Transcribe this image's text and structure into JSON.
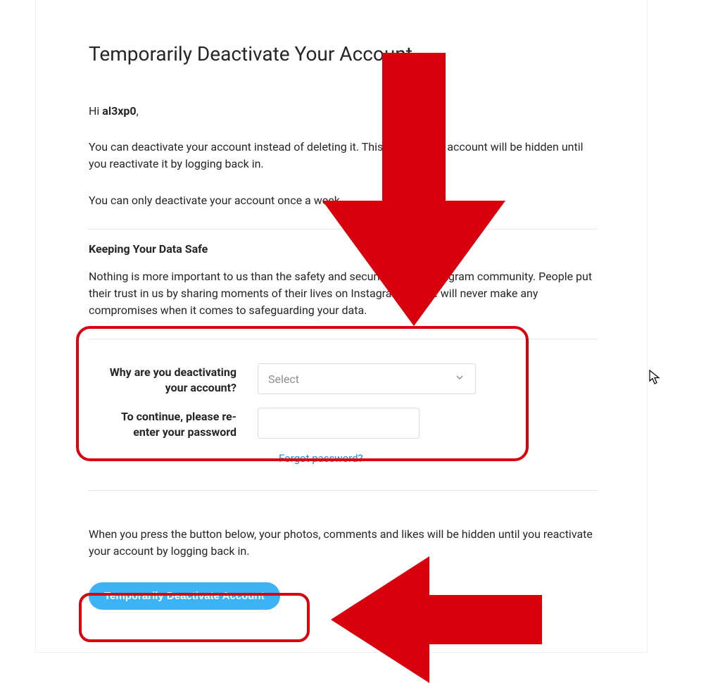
{
  "title": "Temporarily Deactivate Your Account",
  "greeting_prefix": "Hi ",
  "username": "al3xp0",
  "greeting_suffix": ",",
  "intro_para": "You can deactivate your account instead of deleting it. This means your account will be hidden until you reactivate it by logging back in.",
  "limit_para": "You can only deactivate your account once a week.",
  "safe_heading": "Keeping Your Data Safe",
  "safe_para": "Nothing is more important to us than the safety and security of the Instagram community. People put their trust in us by sharing moments of their lives on Instagram. So we will never make any compromises when it comes to safeguarding your data.",
  "form": {
    "reason_label": "Why are you deactivating your account?",
    "reason_placeholder": "Select",
    "password_label": "To continue, please re-enter your password",
    "forgot_link": "Forgot password?"
  },
  "warning_para": "When you press the button below, your photos, comments and likes will be hidden until you reactivate your account by logging back in.",
  "button_label": "Temporarily Deactivate Account"
}
